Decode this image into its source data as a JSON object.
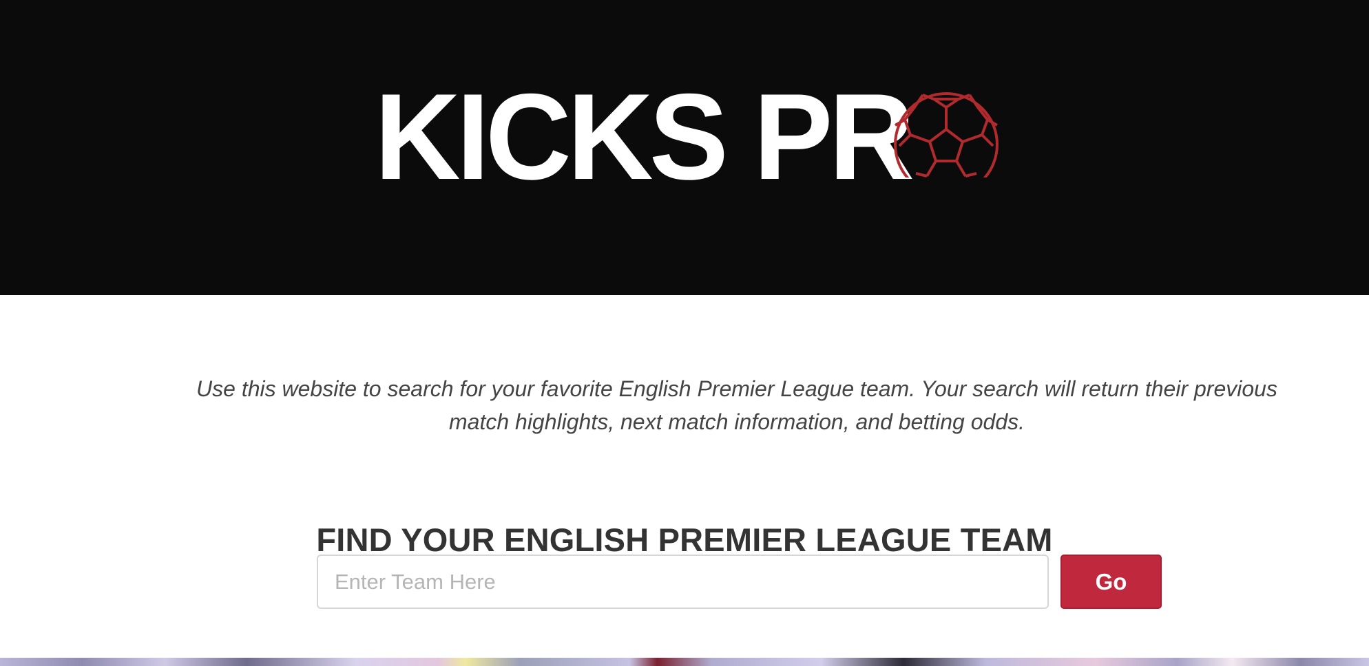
{
  "header": {
    "logo_text": "KICKS PR",
    "logo_ball_icon": "soccer-ball-icon",
    "logo_ball_color": "#b02a2e",
    "background_color": "#0b0b0b"
  },
  "intro": {
    "text": "Use this website to search for your favorite English Premier League team. Your search will return their previous match highlights, next match information, and betting odds."
  },
  "search": {
    "title": "FIND YOUR ENGLISH PREMIER LEAGUE TEAM",
    "placeholder": "Enter Team Here",
    "value": "",
    "button_label": "Go",
    "button_color": "#c0283d"
  }
}
